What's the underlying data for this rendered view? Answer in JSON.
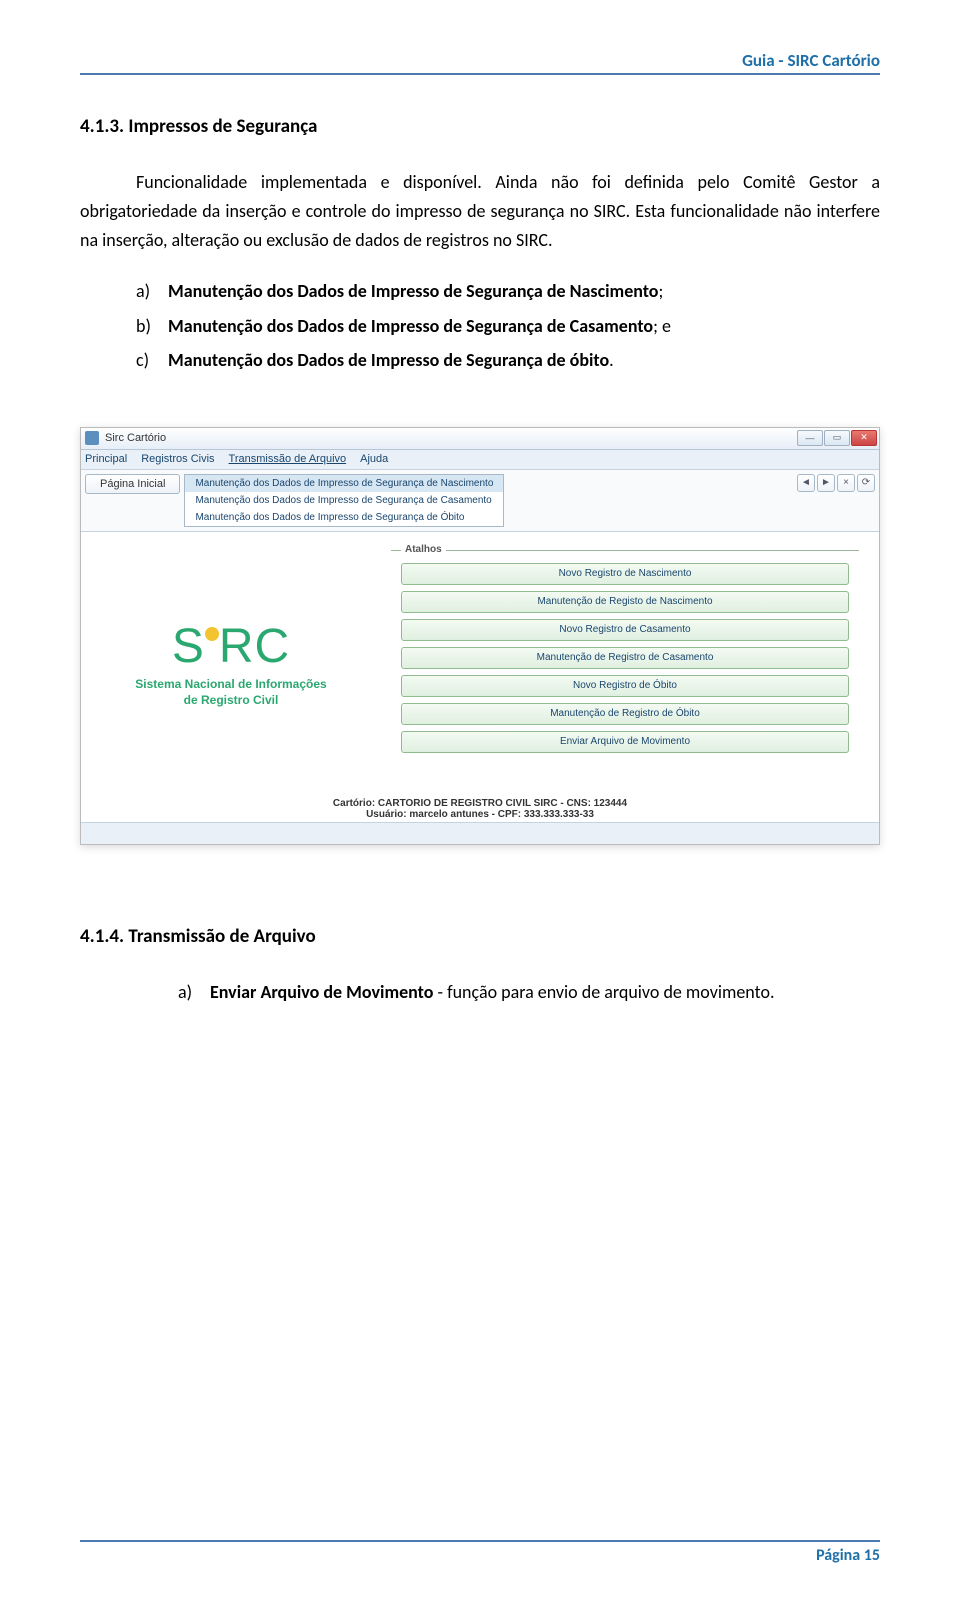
{
  "header": {
    "title": "Guia - SIRC Cartório"
  },
  "section413": {
    "heading": "4.1.3.  Impressos de Segurança",
    "para": "Funcionalidade implementada e disponível. Ainda não foi definida pelo Comitê Gestor a obrigatoriedade da inserção e controle do impresso de segurança no SIRC. Esta funcionalidade não interfere na inserção, alteração ou exclusão de dados de registros no SIRC.",
    "items": [
      {
        "marker": "a)",
        "bold": "Manutenção dos Dados de Impresso de Segurança de Nascimento",
        "tail": ";"
      },
      {
        "marker": "b)",
        "bold": "Manutenção dos Dados de Impresso de Segurança de Casamento",
        "tail": "; e"
      },
      {
        "marker": "c)",
        "bold": "Manutenção dos Dados de Impresso de Segurança de óbito",
        "tail": "."
      }
    ]
  },
  "screenshot": {
    "title": "Sirc Cartório",
    "menubar": [
      "Principal",
      "Registros Civis",
      "Transmissão de Arquivo",
      "Ajuda"
    ],
    "pagina_inicial": "Página Inicial",
    "dropdown": [
      "Manutenção dos Dados de Impresso de Segurança de Nascimento",
      "Manutenção dos Dados de Impresso de Segurança de Casamento",
      "Manutenção dos Dados de Impresso de Segurança de Óbito"
    ],
    "logo_line1": "S",
    "logo_line2": "RC",
    "logo_sub1": "Sistema Nacional de Informações",
    "logo_sub2": "de Registro Civil",
    "atalhos_label": "Atalhos",
    "shortcuts": [
      "Novo Registro de Nascimento",
      "Manutenção de Registo de Nascimento",
      "Novo Registro de Casamento",
      "Manutenção de Registro de Casamento",
      "Novo Registro de Óbito",
      "Manutenção de Registro de Óbito",
      "Enviar Arquivo de Movimento"
    ],
    "footer_cart": "Cartório: CARTORIO DE REGISTRO CIVIL SIRC - CNS: 123444",
    "footer_user": "Usuário: marcelo antunes - CPF: 333.333.333-33",
    "nav": {
      "back": "◄",
      "fwd": "►",
      "stop": "×",
      "refresh": "⟳"
    },
    "win": {
      "min": "—",
      "max": "▭",
      "close": "✕"
    }
  },
  "section414": {
    "heading": "4.1.4.  Transmissão de Arquivo",
    "item_marker": "a)",
    "item_bold": "Enviar Arquivo de Movimento",
    "item_tail": " - função para envio de arquivo de movimento."
  },
  "footer": {
    "page": "Página 15"
  }
}
